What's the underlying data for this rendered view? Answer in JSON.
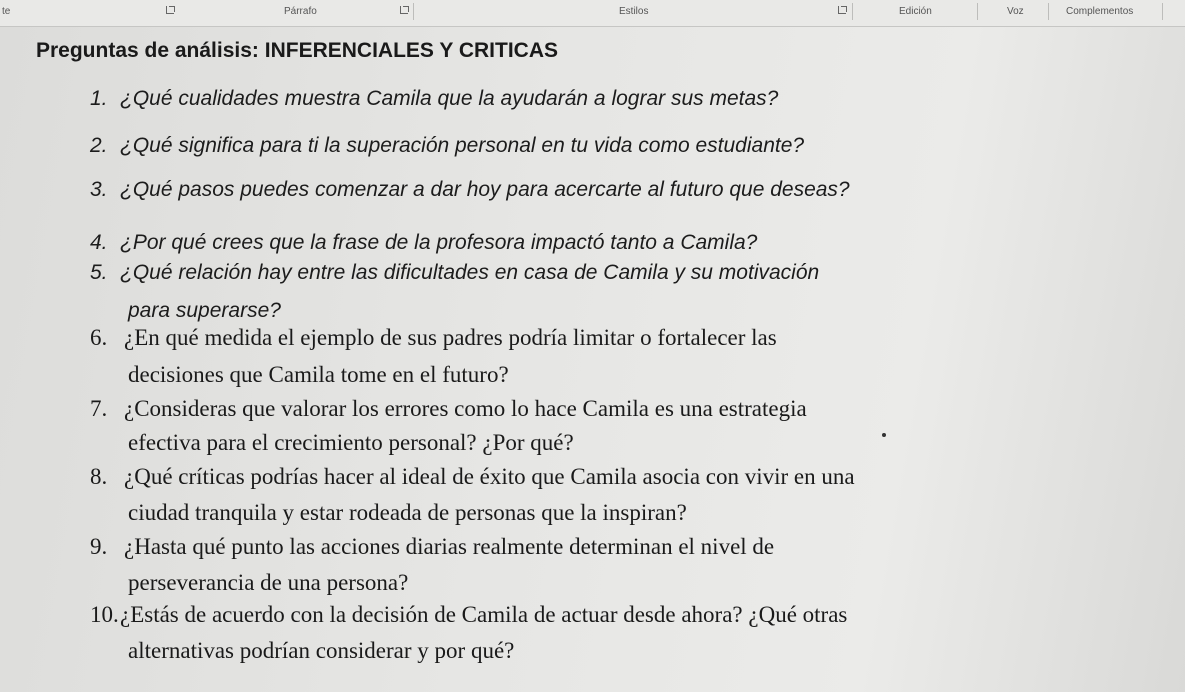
{
  "ribbon": {
    "partial_left": "te",
    "paragraph_label": "Párrafo",
    "styles_label": "Estilos",
    "edit_label": "Edición",
    "voice_label": "Voz",
    "addins_label": "Complementos"
  },
  "document": {
    "heading": "Preguntas de análisis: INFERENCIALES Y CRITICAS",
    "questions": [
      {
        "number": "1.",
        "lines": [
          "¿Qué cualidades muestra Camila que la ayudarán a lograr sus metas?"
        ]
      },
      {
        "number": "2.",
        "lines": [
          "¿Qué significa para ti la superación personal en tu vida como estudiante?"
        ]
      },
      {
        "number": "3.",
        "lines": [
          "¿Qué pasos puedes comenzar a dar hoy para acercarte al futuro que deseas?"
        ]
      },
      {
        "number": "4.",
        "lines": [
          "¿Por qué crees que la frase de la profesora impactó tanto a Camila?"
        ]
      },
      {
        "number": "5.",
        "lines": [
          "¿Qué relación hay entre las dificultades en casa de Camila y su motivación",
          "para superarse?"
        ]
      },
      {
        "number": "6.",
        "lines": [
          "¿En qué medida el ejemplo de sus padres podría limitar o fortalecer las",
          "decisiones que Camila tome en el futuro?"
        ]
      },
      {
        "number": "7.",
        "lines": [
          "¿Consideras que valorar los errores como lo hace Camila es una estrategia",
          "efectiva para el crecimiento personal? ¿Por qué?"
        ]
      },
      {
        "number": "8.",
        "lines": [
          "¿Qué críticas podrías hacer al ideal de éxito que Camila asocia con vivir en una",
          "ciudad tranquila y estar rodeada de personas que la inspiran?"
        ]
      },
      {
        "number": "9.",
        "lines": [
          "¿Hasta qué punto las acciones diarias realmente determinan el nivel de",
          "perseverancia de una persona?"
        ]
      },
      {
        "number": "10.",
        "lines": [
          "¿Estás de acuerdo con la decisión de Camila de actuar desde ahora? ¿Qué otras",
          "alternativas podrían considerar y por qué?"
        ]
      }
    ]
  }
}
